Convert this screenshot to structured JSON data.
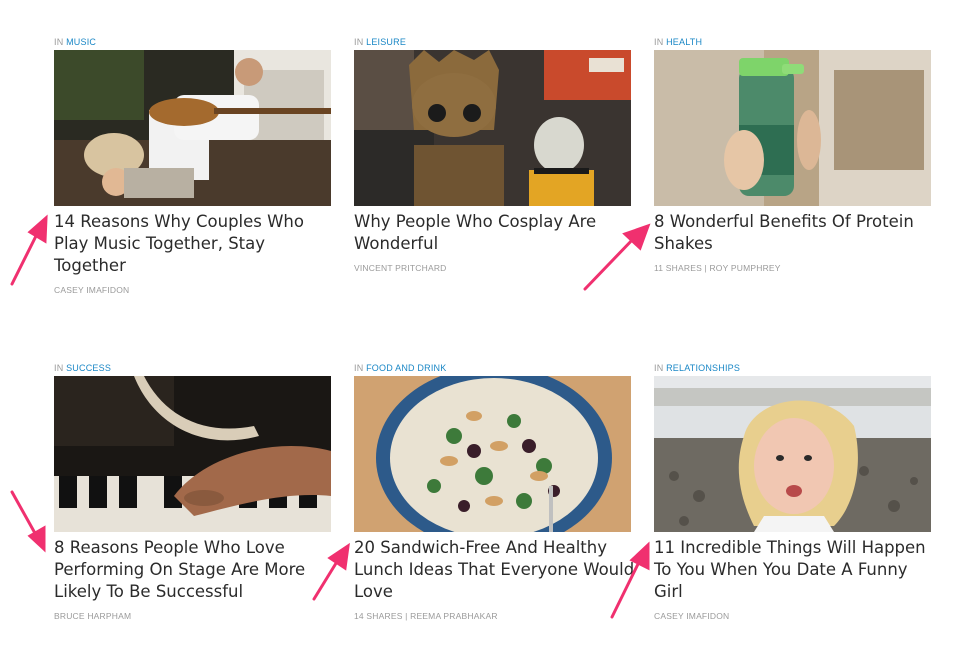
{
  "arrow_color": "#f0306f",
  "category_prefix": "IN",
  "articles": [
    {
      "category": "MUSIC",
      "title": "14 Reasons Why Couples Who Play Music Together, Stay Together",
      "meta": "CASEY IMAFIDON"
    },
    {
      "category": "LEISURE",
      "title": "Why People Who Cosplay Are Wonderful",
      "meta": "VINCENT PRITCHARD"
    },
    {
      "category": "HEALTH",
      "title": "8 Wonderful Benefits Of Protein Shakes",
      "meta": "11 SHARES | ROY PUMPHREY"
    },
    {
      "category": "SUCCESS",
      "title": "8 Reasons People Who Love Performing On Stage Are More Likely To Be Successful",
      "meta": "BRUCE HARPHAM"
    },
    {
      "category": "FOOD AND DRINK",
      "title": "20 Sandwich-Free And Healthy Lunch Ideas That Everyone Would Love",
      "meta": "14 SHARES | REEMA PRABHAKAR"
    },
    {
      "category": "RELATIONSHIPS",
      "title": "11 Incredible Things Will Happen To You When You Date A Funny Girl",
      "meta": "CASEY IMAFIDON"
    }
  ]
}
